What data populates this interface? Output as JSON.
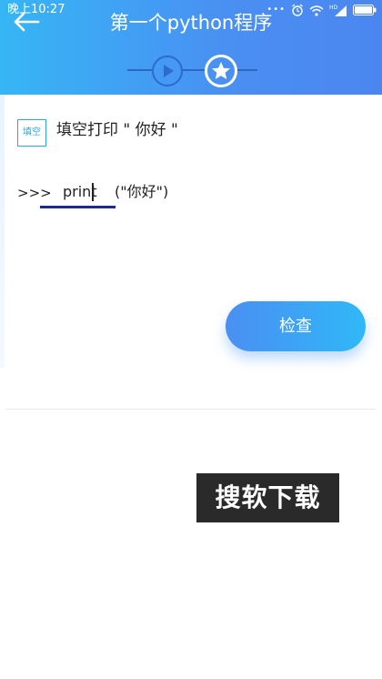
{
  "status_bar": {
    "time": "晚上10:27",
    "network": "HD"
  },
  "header": {
    "title": "第一个python程序"
  },
  "exercise": {
    "badge": "填空",
    "question": "填空打印 \" 你好 \"",
    "prompt": ">>>",
    "answer_value": "print",
    "code_rest": "(\"你好\")"
  },
  "actions": {
    "check_label": "检查"
  },
  "watermark": {
    "text": "搜软下载"
  },
  "colors": {
    "header_start": "#36b6f5",
    "header_end": "#4b86f0",
    "accent": "#2aa8e0",
    "underline": "#1d2a8f"
  },
  "icons": [
    "back-arrow-icon",
    "play-icon",
    "star-icon",
    "alarm-icon",
    "wifi-icon",
    "signal-icon",
    "battery-icon"
  ]
}
